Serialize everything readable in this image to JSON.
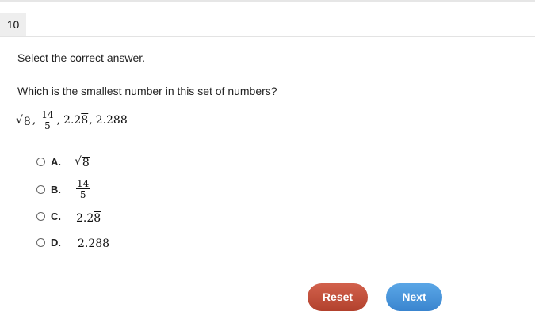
{
  "question_number": "10",
  "instruction": "Select the correct answer.",
  "question": "Which is the smallest number in this set of numbers?",
  "number_set": {
    "sqrt_radicand": "8",
    "fraction_numerator": "14",
    "fraction_denominator": "5",
    "decimal_repeating_prefix": "2.2",
    "decimal_repeating_digit": "8",
    "decimal_plain": "2.288",
    "separator": ","
  },
  "options": [
    {
      "letter": "A.",
      "kind": "sqrt",
      "radicand": "8"
    },
    {
      "letter": "B.",
      "kind": "fraction",
      "numerator": "14",
      "denominator": "5"
    },
    {
      "letter": "C.",
      "kind": "repeating",
      "prefix": "2.2",
      "repeat": "8"
    },
    {
      "letter": "D.",
      "kind": "plain",
      "text": "2.288"
    }
  ],
  "buttons": {
    "reset_label": "Reset",
    "next_label": "Next"
  },
  "colors": {
    "reset": "#c4513c",
    "next": "#4a96de"
  }
}
